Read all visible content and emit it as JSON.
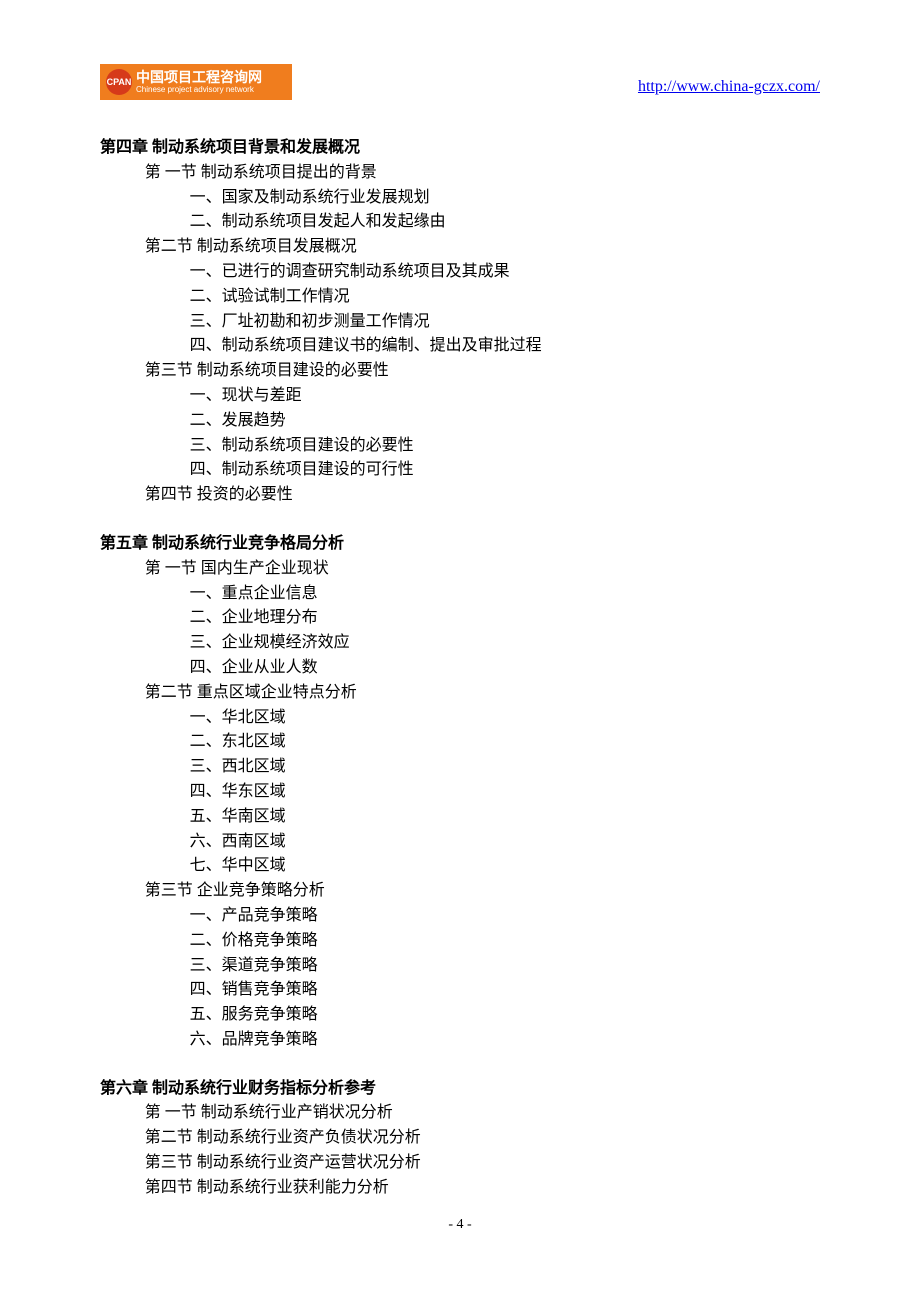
{
  "header": {
    "logo_abbr": "CPAN",
    "logo_cn": "中国项目工程咨询网",
    "logo_en": "Chinese project advisory network",
    "url": "http://www.china-gczx.com/"
  },
  "chapters": [
    {
      "title": "第四章 制动系统项目背景和发展概况",
      "sections": [
        {
          "title": "第 一节 制动系统项目提出的背景",
          "items": [
            "一、国家及制动系统行业发展规划",
            "二、制动系统项目发起人和发起缘由"
          ]
        },
        {
          "title": "第二节 制动系统项目发展概况",
          "items": [
            "一、已进行的调查研究制动系统项目及其成果",
            "二、试验试制工作情况",
            "三、厂址初勘和初步测量工作情况",
            "四、制动系统项目建议书的编制、提出及审批过程"
          ]
        },
        {
          "title": "第三节 制动系统项目建设的必要性",
          "items": [
            "一、现状与差距",
            "二、发展趋势",
            "三、制动系统项目建设的必要性",
            "四、制动系统项目建设的可行性"
          ]
        },
        {
          "title": "第四节  投资的必要性",
          "items": []
        }
      ]
    },
    {
      "title": "第五章 制动系统行业竞争格局分析",
      "sections": [
        {
          "title": "第 一节  国内生产企业现状",
          "items": [
            "一、重点企业信息",
            "二、企业地理分布",
            "三、企业规模经济效应",
            "四、企业从业人数"
          ]
        },
        {
          "title": "第二节  重点区域企业特点分析",
          "items": [
            "一、华北区域",
            "二、东北区域",
            "三、西北区域",
            "四、华东区域",
            "五、华南区域",
            "六、西南区域",
            "七、华中区域"
          ]
        },
        {
          "title": "第三节  企业竞争策略分析",
          "items": [
            "一、产品竞争策略",
            "二、价格竞争策略",
            "三、渠道竞争策略",
            "四、销售竞争策略",
            "五、服务竞争策略",
            "六、品牌竞争策略"
          ]
        }
      ]
    },
    {
      "title": "第六章 制动系统行业财务指标分析参考",
      "sections": [
        {
          "title": "第 一节 制动系统行业产销状况分析",
          "items": []
        },
        {
          "title": "第二节 制动系统行业资产负债状况分析",
          "items": []
        },
        {
          "title": "第三节 制动系统行业资产运营状况分析",
          "items": []
        },
        {
          "title": "第四节 制动系统行业获利能力分析",
          "items": []
        }
      ]
    }
  ],
  "page_number": "- 4 -"
}
